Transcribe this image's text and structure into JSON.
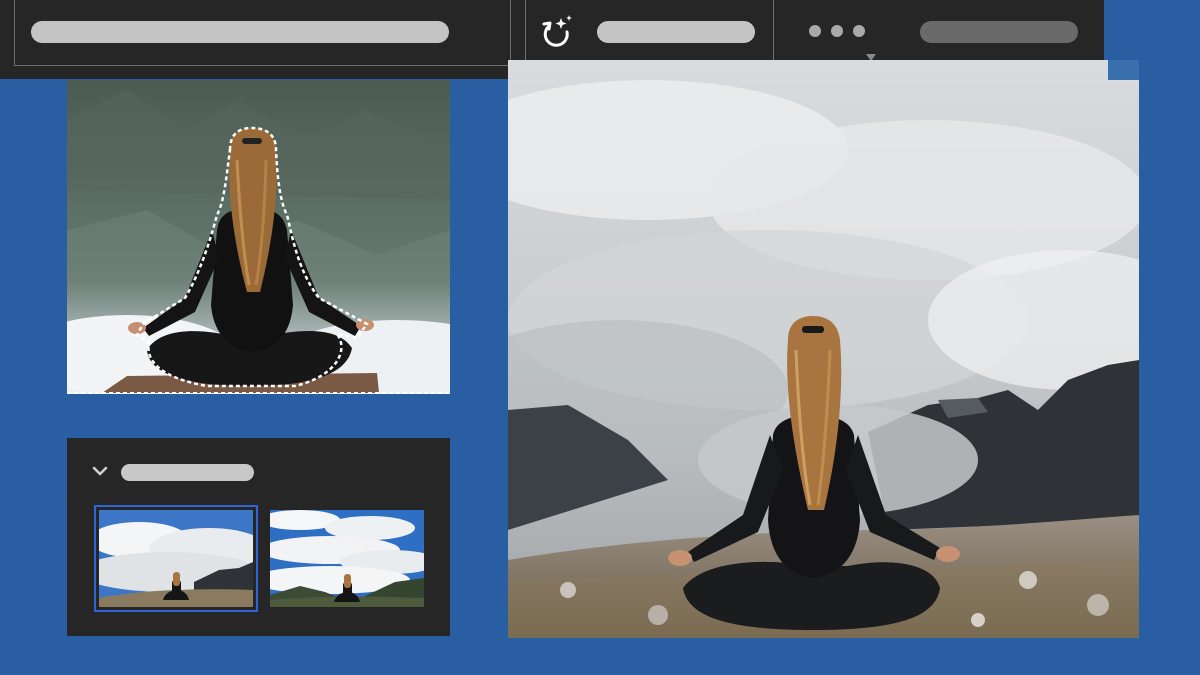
{
  "toolbar": {
    "path_placeholder": "",
    "action_placeholder": "",
    "account_placeholder": "",
    "icons": [
      "magic-rotate-icon",
      "more-options-icon",
      "dropdown-caret-icon"
    ]
  },
  "selection_preview": {
    "selection_style": "marching-ants"
  },
  "layers_panel": {
    "header_placeholder": "",
    "expanded": true,
    "thumbnails": [
      {
        "id": "variation-1",
        "selected": true
      },
      {
        "id": "variation-2",
        "selected": false
      }
    ]
  },
  "colors": {
    "background": "#2a5ea3",
    "panel": "#262626",
    "placeholder_bar": "#c8c8c8",
    "selection_accent": "#2e64d6"
  }
}
